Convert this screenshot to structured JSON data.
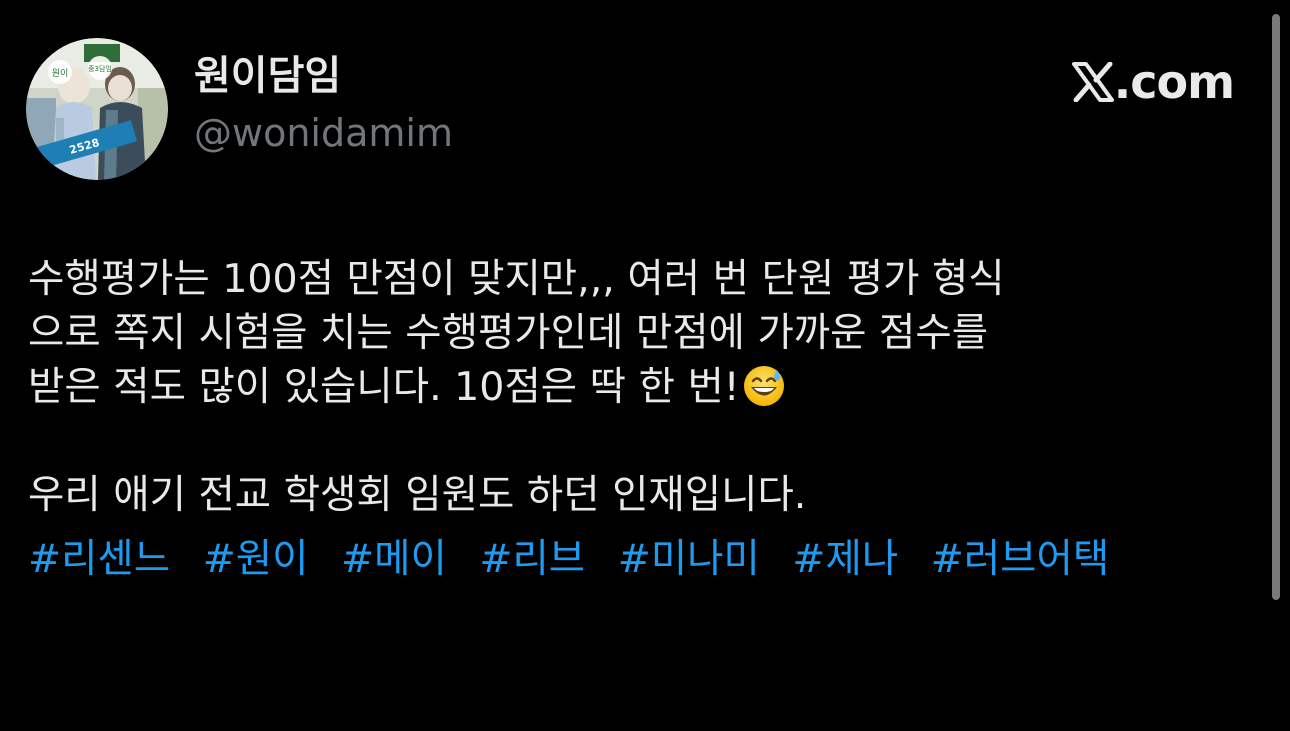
{
  "author": {
    "display_name": "원이담임",
    "handle": "@wonidamim",
    "avatar": {
      "icon": "profile-photo",
      "badge_left": "원이",
      "badge_right": "중3담임",
      "board_number": "2528"
    }
  },
  "brand": {
    "logo_icon": "x-logo-icon",
    "logo_mark": "𝕏",
    "domain": ".com"
  },
  "tweet": {
    "lines": [
      "수행평가는 100점 만점이 맞지만,,, 여러 번 단원 평가 형식",
      "으로 쪽지 시험을 치는 수행평가인데 만점에 가까운 점수를",
      "받은 적도 많이 있습니다. 10점은 딱 한 번!"
    ],
    "emoji": "grinning-face-with-sweat",
    "line2": "우리 애기 전교 학생회 임원도 하던 인재입니다.",
    "hashtags": [
      "#리센느",
      "#원이",
      "#메이",
      "#리브",
      "#미나미",
      "#제나",
      "#러브어택"
    ]
  },
  "colors": {
    "background": "#000000",
    "text": "#e7e9ea",
    "handle": "#71767b",
    "hashtag": "#1d9bf0"
  }
}
